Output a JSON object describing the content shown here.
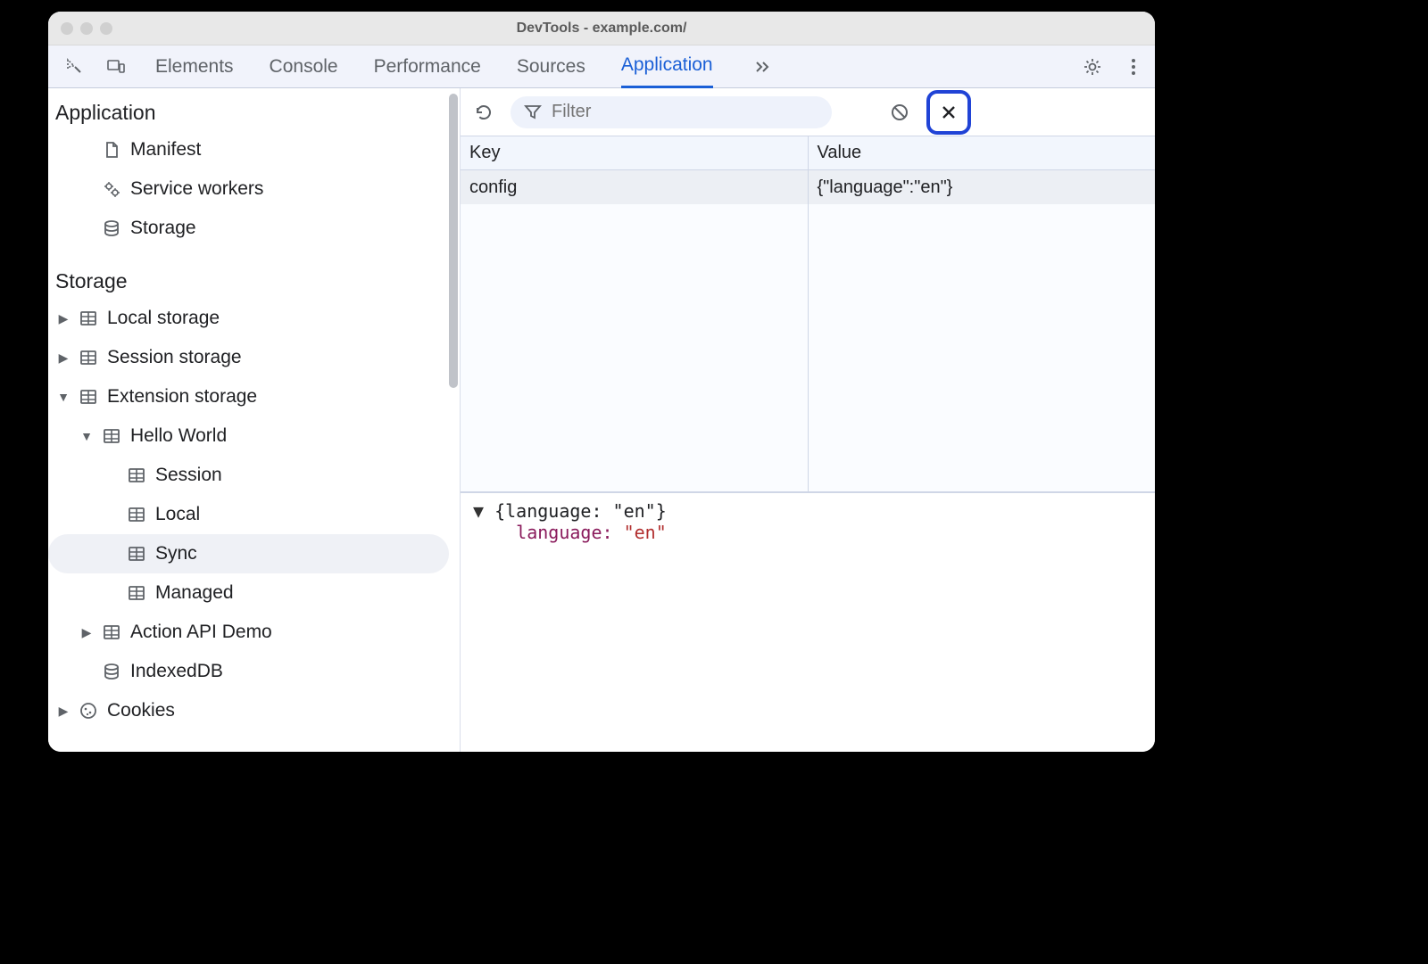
{
  "window": {
    "title": "DevTools - example.com/"
  },
  "tabs": {
    "items": [
      "Elements",
      "Console",
      "Performance",
      "Sources",
      "Application"
    ],
    "active_index": 4
  },
  "sidebar": {
    "groups": [
      {
        "label": "Application",
        "items": [
          {
            "label": "Manifest",
            "icon": "document"
          },
          {
            "label": "Service workers",
            "icon": "gears"
          },
          {
            "label": "Storage",
            "icon": "database"
          }
        ]
      },
      {
        "label": "Storage",
        "items": [
          {
            "label": "Local storage",
            "icon": "table",
            "caret": "right"
          },
          {
            "label": "Session storage",
            "icon": "table",
            "caret": "right"
          },
          {
            "label": "Extension storage",
            "icon": "table",
            "caret": "down",
            "children": [
              {
                "label": "Hello World",
                "icon": "table",
                "caret": "down",
                "children": [
                  {
                    "label": "Session",
                    "icon": "table"
                  },
                  {
                    "label": "Local",
                    "icon": "table"
                  },
                  {
                    "label": "Sync",
                    "icon": "table",
                    "selected": true
                  },
                  {
                    "label": "Managed",
                    "icon": "table"
                  }
                ]
              },
              {
                "label": "Action API Demo",
                "icon": "table",
                "caret": "right"
              }
            ]
          },
          {
            "label": "IndexedDB",
            "icon": "database"
          },
          {
            "label": "Cookies",
            "icon": "cookie",
            "caret": "right"
          }
        ]
      }
    ]
  },
  "toolbar": {
    "filter_placeholder": "Filter"
  },
  "table": {
    "columns": [
      "Key",
      "Value"
    ],
    "rows": [
      {
        "key": "config",
        "value": "{\"language\":\"en\"}"
      }
    ]
  },
  "jsonview": {
    "summary": "{language: \"en\"}",
    "key": "language",
    "value": "\"en\""
  }
}
